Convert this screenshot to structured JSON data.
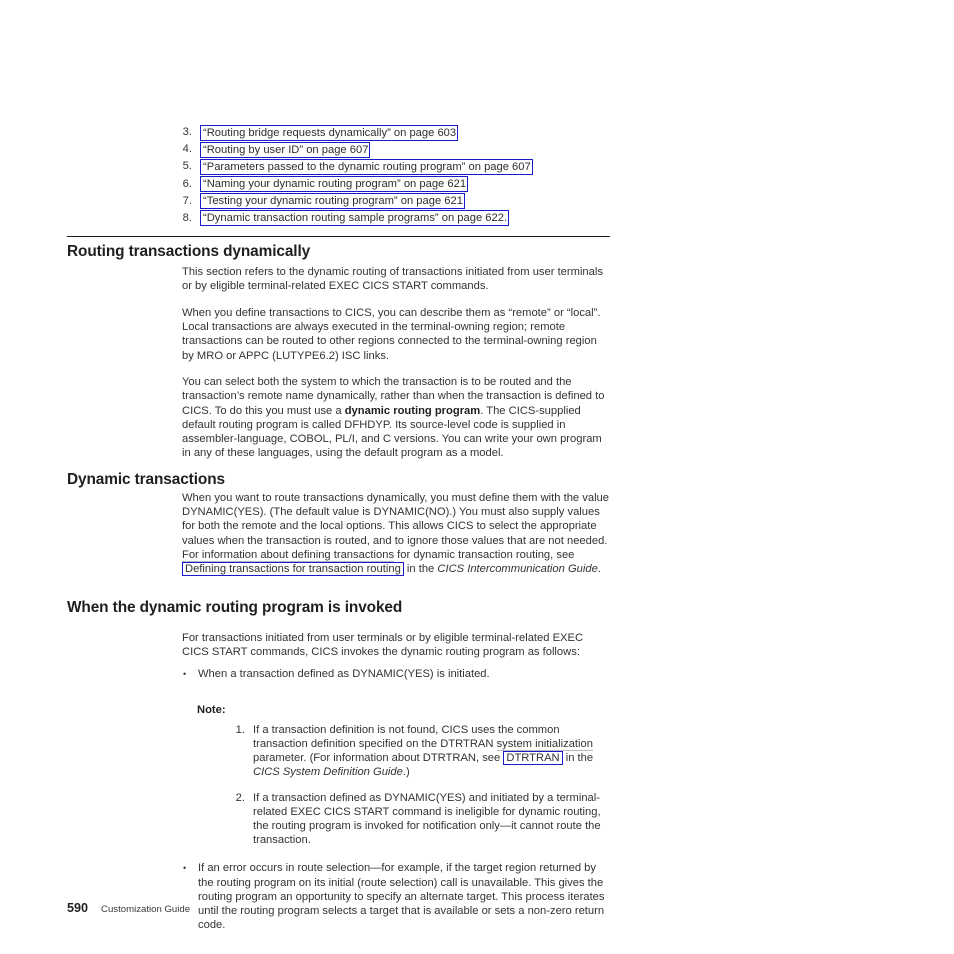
{
  "xref_list": {
    "items": [
      {
        "num": "3.",
        "text": "“Routing bridge requests dynamically” on page 603"
      },
      {
        "num": "4.",
        "text": "“Routing by user ID” on page 607"
      },
      {
        "num": "5.",
        "text": "“Parameters passed to the dynamic routing program” on page 607"
      },
      {
        "num": "6.",
        "text": "“Naming your dynamic routing program” on page 621"
      },
      {
        "num": "7.",
        "text": "“Testing your dynamic routing program” on page 621"
      },
      {
        "num": "8.",
        "text": "“Dynamic transaction routing sample programs” on page 622."
      }
    ]
  },
  "section1": {
    "heading": "Routing transactions dynamically",
    "para1": "This section refers to the dynamic routing of transactions initiated from user terminals or by eligible terminal-related EXEC CICS START commands.",
    "para2": "When you define transactions to CICS, you can describe them as “remote” or “local”. Local transactions are always executed in the terminal-owning region; remote transactions can be routed to other regions connected to the terminal-owning region by MRO or APPC (LUTYPE6.2) ISC links.",
    "para3_a": "You can select both the system to which the transaction is to be routed and the transaction’s remote name dynamically, rather than when the transaction is defined to CICS. To do this you must use a ",
    "para3_bold": "dynamic routing program",
    "para3_b": ". The CICS-supplied default routing program is called DFHDYP. Its source-level code is supplied in assembler-language, COBOL, PL/I, and C versions. You can write your own program in any of these languages, using the default program as a model."
  },
  "section2": {
    "heading": "Dynamic transactions",
    "para1_a": "When you want to route transactions dynamically, you must define them with the value DYNAMIC(YES). (The default value is DYNAMIC(NO).) You must also supply values for both the remote and the local options. This allows CICS to select the appropriate values when the transaction is routed, and to ignore those values that are not needed. ",
    "para1_underlined": "For information about defining transactions",
    "para1_b": " for dynamic transaction routing, see ",
    "para1_link": "Defining transactions for transaction routing",
    "para1_c": " in the ",
    "para1_italic": "CICS Intercommunication Guide",
    "para1_d": "."
  },
  "section3": {
    "heading": "When the dynamic routing program is invoked",
    "para1": "For transactions initiated from user terminals or by eligible terminal-related EXEC CICS START commands, CICS invokes the dynamic routing program as follows:",
    "bullet1": "When a transaction defined as DYNAMIC(YES) is initiated.",
    "note_label": "Note:",
    "notes": [
      {
        "num": "1.",
        "text_a": "If a transaction definition is not found, CICS uses the common transaction definition specified on the DTRTRAN ",
        "underlined": "system initialization",
        "text_b": " parameter. (For information about DTRTRAN, see ",
        "link": "DTRTRAN",
        "text_c": " in the ",
        "italic": "CICS System Definition Guide",
        "text_d": ".)"
      },
      {
        "num": "2.",
        "text_a": "If a transaction defined as DYNAMIC(YES) and initiated by a terminal-related EXEC CICS START command is ineligible for dynamic routing, the routing program is invoked for notification only—it cannot route the transaction.",
        "underlined": "",
        "text_b": "",
        "link": "",
        "text_c": "",
        "italic": "",
        "text_d": ""
      }
    ],
    "bullet2": "If an error occurs in route selection—for example, if the target region returned by the routing program on its initial (route selection) call is unavailable. This gives the routing program an opportunity to specify an alternate target. This process iterates until the routing program selects a target that is available or sets a non-zero return code."
  },
  "footer": {
    "page_number": "590",
    "document_title": "Customization Guide"
  },
  "colors": {
    "link_border": "#1a1acc",
    "text": "#333333",
    "heading": "#1f1f1f"
  }
}
